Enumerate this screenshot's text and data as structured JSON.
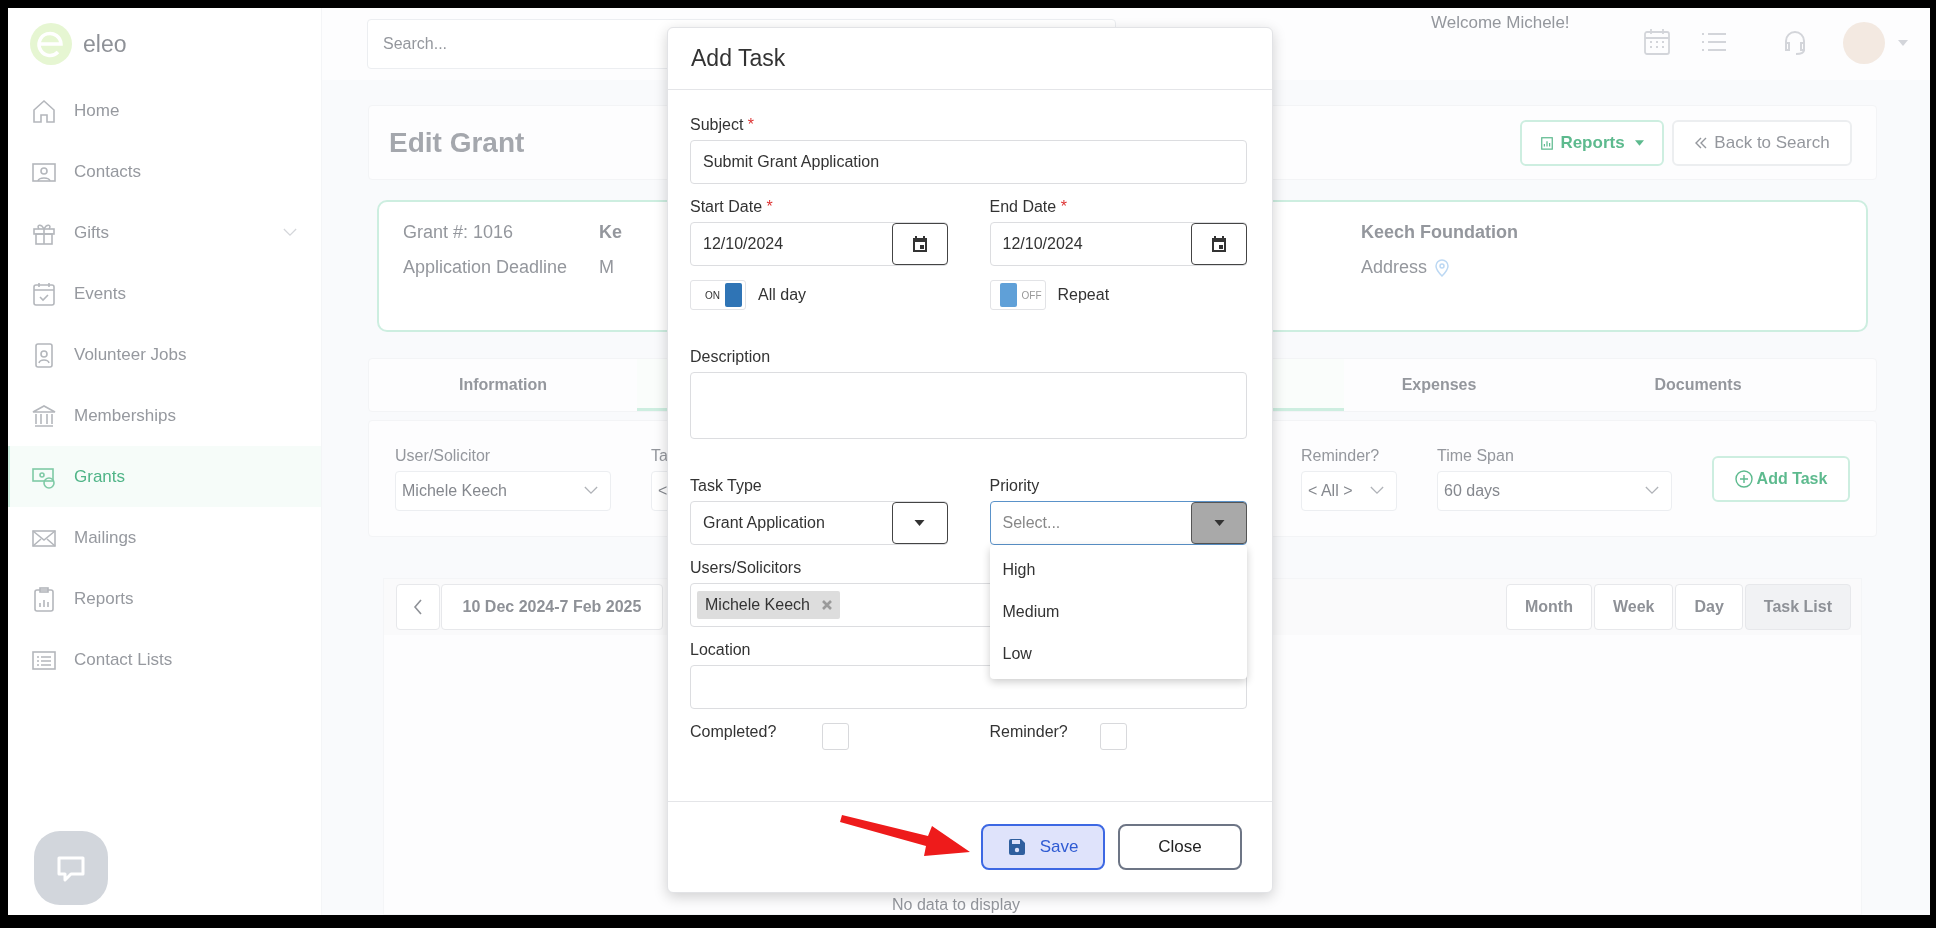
{
  "sidebar": {
    "logo_text": "eleo",
    "items": [
      {
        "label": "Home",
        "kind": "home",
        "selected": false,
        "expandable": false
      },
      {
        "label": "Contacts",
        "kind": "contacts",
        "selected": false,
        "expandable": false
      },
      {
        "label": "Gifts",
        "kind": "gift",
        "selected": false,
        "expandable": true
      },
      {
        "label": "Events",
        "kind": "event",
        "selected": false,
        "expandable": false
      },
      {
        "label": "Volunteer Jobs",
        "kind": "idcard",
        "selected": false,
        "expandable": false
      },
      {
        "label": "Memberships",
        "kind": "bank",
        "selected": false,
        "expandable": false
      },
      {
        "label": "Grants",
        "kind": "money",
        "selected": true,
        "expandable": false
      },
      {
        "label": "Mailings",
        "kind": "mail",
        "selected": false,
        "expandable": false
      },
      {
        "label": "Reports",
        "kind": "report",
        "selected": false,
        "expandable": false
      },
      {
        "label": "Contact Lists",
        "kind": "list",
        "selected": false,
        "expandable": false
      }
    ]
  },
  "topbar": {
    "search": {
      "placeholder": "Search..."
    },
    "welcome": "Welcome Michele!"
  },
  "page": {
    "title": "Edit Grant",
    "buttons": [
      {
        "label": "Reports",
        "kind": "dropdown"
      },
      {
        "label": "Back to Search",
        "kind": "back"
      }
    ]
  },
  "grant_card": {
    "columns": [
      {
        "title": "Grant #: 1016",
        "subtitle": "Application Deadline",
        "bold": false,
        "kind": "plain"
      },
      {
        "title": "Ke",
        "subtitle": "M",
        "bold": true,
        "kind": "plain"
      },
      {
        "title": "Keech Foundation",
        "subtitle": "Address",
        "bold": true,
        "kind": "address"
      }
    ]
  },
  "tabs": [
    {
      "label": "Information",
      "selected": false
    },
    {
      "selected": true
    },
    {
      "label": "Expenses",
      "selected": false
    },
    {
      "label": "Documents",
      "selected": false
    }
  ],
  "filters": {
    "fields": [
      {
        "label": "User/Solicitor",
        "value": "Michele Keech"
      },
      {
        "label": "Ta",
        "value": "<"
      },
      {
        "label": "Reminder?",
        "value": "< All >"
      },
      {
        "label": "Time Span",
        "value": "60 days"
      }
    ],
    "add_button": "Add Task"
  },
  "calendar": {
    "range": "10 Dec 2024-7 Feb 2025",
    "views": [
      {
        "label": "Month",
        "selected": false
      },
      {
        "label": "Week",
        "selected": false
      },
      {
        "label": "Day",
        "selected": false
      },
      {
        "label": "Task List",
        "selected": true
      }
    ],
    "empty_text": "No data to display"
  },
  "modal": {
    "title": "Add Task",
    "subject": {
      "label": "Subject",
      "required_mark": "*",
      "value": "Submit Grant Application"
    },
    "start_date": {
      "label": "Start Date",
      "required_mark": "*",
      "value": "12/10/2024"
    },
    "end_date": {
      "label": "End Date",
      "required_mark": "*",
      "value": "12/10/2024"
    },
    "all_day": {
      "label": "All day",
      "on": true,
      "switch_text": "ON"
    },
    "repeat": {
      "label": "Repeat",
      "on": false,
      "switch_text": "OFF"
    },
    "description": {
      "label": "Description"
    },
    "task_type": {
      "label": "Task Type",
      "value": "Grant Application"
    },
    "priority": {
      "label": "Priority",
      "placeholder": "Select...",
      "expanded": true,
      "options": [
        "High",
        "Medium",
        "Low"
      ]
    },
    "users": {
      "label": "Users/Solicitors",
      "tags": [
        "Michele Keech"
      ]
    },
    "location": {
      "label": "Location"
    },
    "completed": {
      "label": "Completed?",
      "checked": false
    },
    "reminder": {
      "label": "Reminder?",
      "checked": false
    },
    "buttons": [
      {
        "label": "Save",
        "kind": "primary"
      },
      {
        "label": "Close",
        "kind": "secondary"
      }
    ]
  }
}
